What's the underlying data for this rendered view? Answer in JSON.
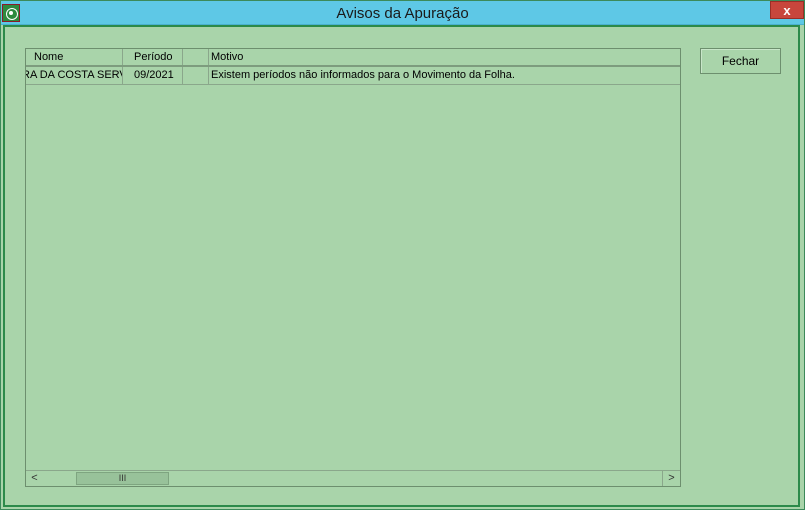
{
  "window": {
    "title": "Avisos da Apuração",
    "close_label": "x"
  },
  "grid": {
    "columns": [
      "Nome",
      "Período",
      "",
      "Motivo"
    ],
    "rows": [
      {
        "nome": "RA DA COSTA SERV",
        "periodo": "09/2021",
        "flag": "",
        "motivo": "Existem períodos não informados para o Movimento da Folha."
      }
    ]
  },
  "scrollbar": {
    "left_arrow": "<",
    "right_arrow": ">",
    "thumb_grip": "III"
  },
  "actions": {
    "close_button": "Fechar"
  }
}
